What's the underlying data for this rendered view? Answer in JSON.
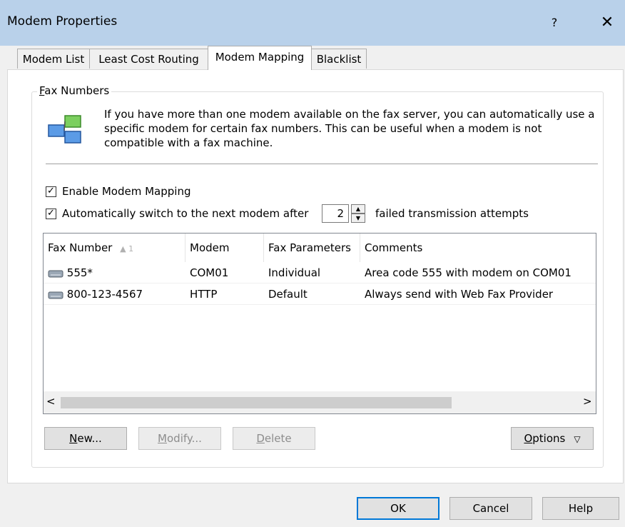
{
  "window": {
    "title": "Modem Properties",
    "help_glyph": "?",
    "close_glyph": "✕"
  },
  "tabs": [
    {
      "label": "Modem List",
      "active": false
    },
    {
      "label": "Least Cost Routing",
      "active": false
    },
    {
      "label": "Modem Mapping",
      "active": true
    },
    {
      "label": "Blacklist",
      "active": false
    }
  ],
  "group": {
    "label_accel": "F",
    "label_rest": "ax Numbers",
    "info": "If you have more than one modem available on the fax server, you can automatically use a specific modem for certain fax numbers. This can be useful when a modem is not compatible with a fax machine."
  },
  "options": {
    "enable_label": "Enable Modem Mapping",
    "enable_checked": true,
    "auto_switch_label": "Automatically switch to the next modem after",
    "auto_switch_checked": true,
    "attempts_value": "2",
    "attempts_suffix": "failed transmission attempts"
  },
  "table": {
    "columns": [
      "Fax Number",
      "Modem",
      "Fax Parameters",
      "Comments"
    ],
    "sort_indicator": "▲ 1",
    "rows": [
      {
        "fax_number": "555*",
        "modem": "COM01",
        "fax_parameters": "Individual",
        "comments": "Area code 555 with modem on COM01"
      },
      {
        "fax_number": "800-123-4567",
        "modem": "HTTP",
        "fax_parameters": "Default",
        "comments": "Always send with Web Fax Provider"
      }
    ],
    "scroll_left": "<",
    "scroll_right": ">"
  },
  "buttons": {
    "new_accel": "N",
    "new_rest": "ew...",
    "modify_accel": "M",
    "modify_rest": "odify...",
    "delete_accel": "D",
    "delete_rest": "elete",
    "options_accel": "O",
    "options_rest": "ptions",
    "options_arrow": "▽",
    "ok": "OK",
    "cancel": "Cancel",
    "help": "Help"
  },
  "colors": {
    "titlebar": "#b9d1ea",
    "default_button_border": "#0078d7",
    "icon_green": "#5cb85c",
    "icon_blue": "#3a7bd5"
  }
}
